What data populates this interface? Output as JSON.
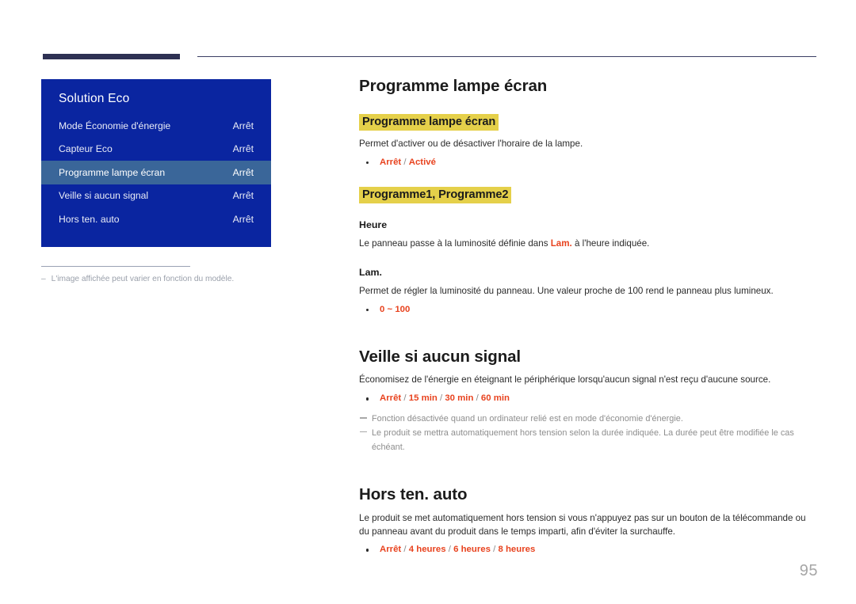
{
  "page": {
    "number": "95"
  },
  "osd": {
    "title": "Solution Eco",
    "rows": [
      {
        "label": "Mode Économie d'énergie",
        "value": "Arrêt",
        "selected": false
      },
      {
        "label": "Capteur Eco",
        "value": "Arrêt",
        "selected": false
      },
      {
        "label": "Programme lampe écran",
        "value": "Arrêt",
        "selected": true
      },
      {
        "label": "Veille si aucun signal",
        "value": "Arrêt",
        "selected": false
      },
      {
        "label": "Hors ten. auto",
        "value": "Arrêt",
        "selected": false
      }
    ],
    "footnote": {
      "dash": "–",
      "text": "L'image affichée peut varier en fonction du modèle."
    },
    "colors": {
      "panel_blue": "#0a25a0",
      "selected_blue": "#3a6699"
    }
  },
  "content": {
    "section1": {
      "heading": "Programme lampe écran",
      "sub1": {
        "highlight": "Programme lampe écran",
        "body": "Permet d'activer ou de désactiver l'horaire de la lampe.",
        "options": {
          "a": "Arrêt",
          "sep1": " / ",
          "b": "Activé"
        }
      },
      "sub2": {
        "highlight": "Programme1, Programme2",
        "heure": {
          "label": "Heure",
          "body_pre": "Le panneau passe à la luminosité définie dans ",
          "body_red": "Lam.",
          "body_post": " à l'heure indiquée."
        },
        "lam": {
          "label": "Lam.",
          "body": "Permet de régler la luminosité du panneau. Une valeur proche de 100 rend le panneau plus lumineux.",
          "options": {
            "a": "0 ~ 100"
          }
        }
      }
    },
    "section2": {
      "heading": "Veille si aucun signal",
      "body": "Économisez de l'énergie en éteignant le périphérique lorsqu'aucun signal n'est reçu d'aucune source.",
      "options": {
        "a": "Arrêt",
        "sep1": " / ",
        "b": "15 min",
        "sep2": " / ",
        "c": "30 min",
        "sep3": " / ",
        "d": "60 min"
      },
      "notes": [
        "Fonction désactivée quand un ordinateur relié est en mode d'économie d'énergie.",
        "Le produit se mettra automatiquement hors tension selon la durée indiquée. La durée peut être modifiée le cas échéant."
      ]
    },
    "section3": {
      "heading": "Hors ten. auto",
      "body": "Le produit se met automatiquement hors tension si vous n'appuyez pas sur un bouton de la télécommande ou du panneau avant du produit dans le temps imparti, afin d'éviter la surchauffe.",
      "options": {
        "a": "Arrêt",
        "sep1": " / ",
        "b": "4 heures",
        "sep2": " / ",
        "c": "6 heures",
        "sep3": " / ",
        "d": "8 heures"
      }
    }
  }
}
